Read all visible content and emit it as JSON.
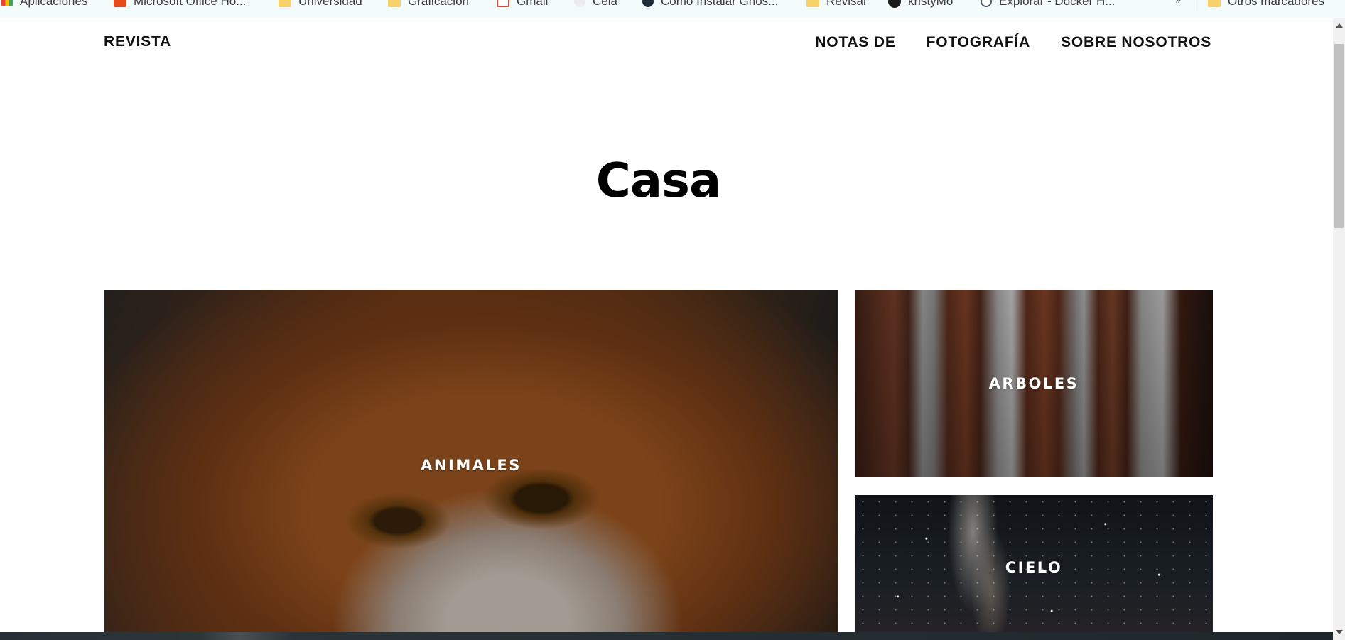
{
  "bookmarks": {
    "items": [
      {
        "label": "Aplicaciones",
        "icon": "apps-grid-icon"
      },
      {
        "label": "Microsoft Office Ho...",
        "icon": "office-icon"
      },
      {
        "label": "Universidad",
        "icon": "folder-icon"
      },
      {
        "label": "Graficación",
        "icon": "folder-icon"
      },
      {
        "label": "Gmail",
        "icon": "gmail-icon"
      },
      {
        "label": "Cela",
        "icon": "globe-icon"
      },
      {
        "label": "Cómo Instalar Ghos...",
        "icon": "site-icon"
      },
      {
        "label": "Revisar",
        "icon": "folder-icon"
      },
      {
        "label": "kristyMo",
        "icon": "github-icon"
      },
      {
        "label": "Explorar - Docker H...",
        "icon": "docker-icon"
      }
    ],
    "more": "»",
    "other": {
      "label": "Otros marcadores",
      "icon": "folder-icon"
    }
  },
  "nav": {
    "brand": "REVISTA",
    "links": [
      "NOTAS DE",
      "FOTOGRAFÍA",
      "SOBRE NOSOTROS"
    ]
  },
  "page": {
    "title": "Casa"
  },
  "cards": [
    {
      "label": "ANIMALES",
      "image": "fox-photo"
    },
    {
      "label": "ARBOLES",
      "image": "redwood-trees-photo"
    },
    {
      "label": "CIELO",
      "image": "milky-way-photo"
    }
  ],
  "colors": {
    "background": "#ffffff",
    "text": "#111111",
    "card_label": "#ffffff"
  }
}
